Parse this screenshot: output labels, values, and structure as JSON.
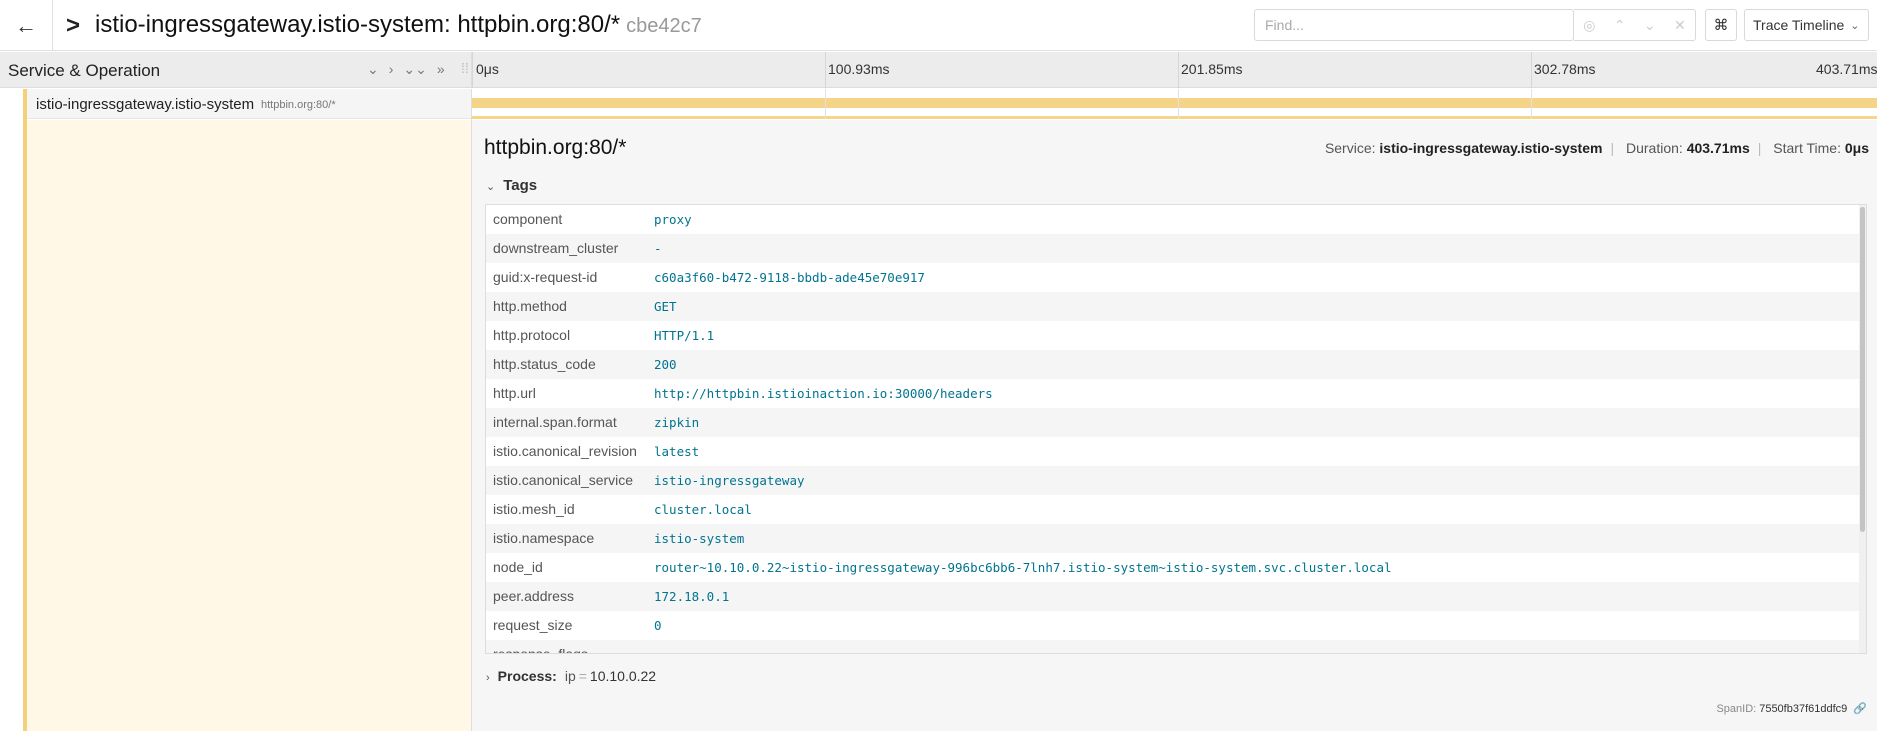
{
  "header": {
    "back_icon": "arrow-left-icon",
    "title": "istio-ingressgateway.istio-system: httpbin.org:80/*",
    "trace_id": "cbe42c7",
    "find_placeholder": "Find...",
    "kbd_icon": "⌘",
    "view_label": "Trace Timeline"
  },
  "left": {
    "header_label": "Service & Operation",
    "span": {
      "service": "istio-ingressgateway.istio-system",
      "operation": "httpbin.org:80/*"
    }
  },
  "timeline": {
    "ticks": [
      "0μs",
      "100.93ms",
      "201.85ms",
      "302.78ms",
      "403.71ms"
    ],
    "bar_color": "#f6d487"
  },
  "detail": {
    "title": "httpbin.org:80/*",
    "service_label": "Service:",
    "service_value": "istio-ingressgateway.istio-system",
    "duration_label": "Duration:",
    "duration_value": "403.71ms",
    "start_label": "Start Time:",
    "start_value": "0μs",
    "tags_label": "Tags",
    "tags": [
      {
        "key": "component",
        "value": "proxy"
      },
      {
        "key": "downstream_cluster",
        "value": "-"
      },
      {
        "key": "guid:x-request-id",
        "value": "c60a3f60-b472-9118-bbdb-ade45e70e917"
      },
      {
        "key": "http.method",
        "value": "GET"
      },
      {
        "key": "http.protocol",
        "value": "HTTP/1.1"
      },
      {
        "key": "http.status_code",
        "value": "200"
      },
      {
        "key": "http.url",
        "value": "http://httpbin.istioinaction.io:30000/headers"
      },
      {
        "key": "internal.span.format",
        "value": "zipkin"
      },
      {
        "key": "istio.canonical_revision",
        "value": "latest"
      },
      {
        "key": "istio.canonical_service",
        "value": "istio-ingressgateway"
      },
      {
        "key": "istio.mesh_id",
        "value": "cluster.local"
      },
      {
        "key": "istio.namespace",
        "value": "istio-system"
      },
      {
        "key": "node_id",
        "value": "router~10.10.0.22~istio-ingressgateway-996bc6bb6-7lnh7.istio-system~istio-system.svc.cluster.local"
      },
      {
        "key": "peer.address",
        "value": "172.18.0.1"
      },
      {
        "key": "request_size",
        "value": "0"
      },
      {
        "key": "response_flags",
        "value": ""
      }
    ],
    "process_label": "Process:",
    "process_key": "ip",
    "process_eq": "=",
    "process_value": "10.10.0.22",
    "spanid_label": "SpanID:",
    "spanid_value": "7550fb37f61ddfc9"
  }
}
